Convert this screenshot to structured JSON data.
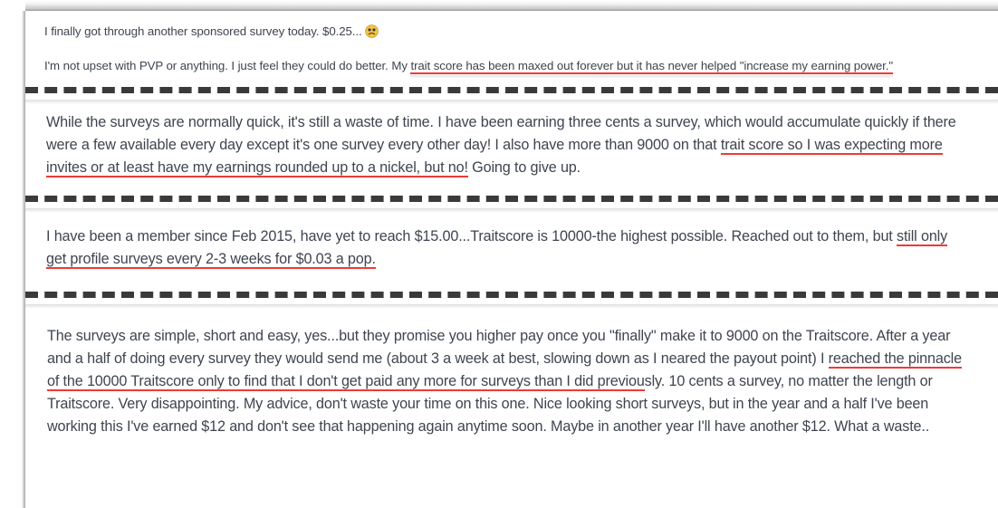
{
  "page": {
    "title": "Customer review excerpts with highlighted phrases",
    "background_color": "#ffffff",
    "text_color": "#3e454f",
    "highlight_color": "#ee3b36",
    "separator_color": "#3a3a3a"
  },
  "reviews": [
    {
      "id": "review-1",
      "paragraphs": [
        {
          "segments": [
            {
              "text": "I finally got through another sponsored survey today. $0.25... ",
              "highlighted": false
            }
          ],
          "emoji": "dizzy-face-emoji"
        },
        {
          "segments": [
            {
              "text": "I'm not upset with PVP or anything. I just feel they could do better. My ",
              "highlighted": false
            },
            {
              "text": "trait score has been maxed out forever but it has never helped \"increase my earning power.\"",
              "highlighted": true
            }
          ]
        }
      ]
    },
    {
      "id": "review-2",
      "paragraphs": [
        {
          "segments": [
            {
              "text": "While the surveys are normally quick, it's still a waste of time. I have been earning three cents a survey, which would accumulate quickly if there were a few available every day except it's one survey every other day! I also have more than 9000 on that ",
              "highlighted": false
            },
            {
              "text": "trait score so I was expecting more invites or at least have my earnings rounded up to a nickel, but no!",
              "highlighted": true
            },
            {
              "text": " Going to give up.",
              "highlighted": false
            }
          ]
        }
      ]
    },
    {
      "id": "review-3",
      "paragraphs": [
        {
          "segments": [
            {
              "text": "I have been a member since Feb 2015, have yet to reach $15.00...Traitscore is 10000-the highest possible. Reached out to them, but ",
              "highlighted": false
            },
            {
              "text": "still only get profile surveys every 2-3 weeks for $0.03 a pop.",
              "highlighted": true
            }
          ]
        }
      ]
    },
    {
      "id": "review-4",
      "paragraphs": [
        {
          "segments": [
            {
              "text": "The surveys are simple, short and easy, yes...but they promise you higher pay once you \"finally\" make it to 9000 on the Traitscore. After a year and a half of doing every survey they would send me (about 3 a week at best, slowing down as I neared the payout point) I ",
              "highlighted": false
            },
            {
              "text": "reached the pinnacle of the 10000 Traitscore only to find that I don't get paid any more for surveys than I did previou",
              "highlighted": true
            },
            {
              "text": "sly. 10 cents a survey, no matter the length or Traitscore. Very disappointing. My advice, don't waste your time on this one. Nice looking short surveys, but in the year and a half I've been working this I've earned $12 and don't see that happening again anytime soon. Maybe in another year I'll have another $12. What a waste..",
              "highlighted": false
            }
          ]
        }
      ]
    }
  ],
  "separators": [
    {
      "id": "separator-1"
    },
    {
      "id": "separator-2"
    },
    {
      "id": "separator-3"
    }
  ]
}
